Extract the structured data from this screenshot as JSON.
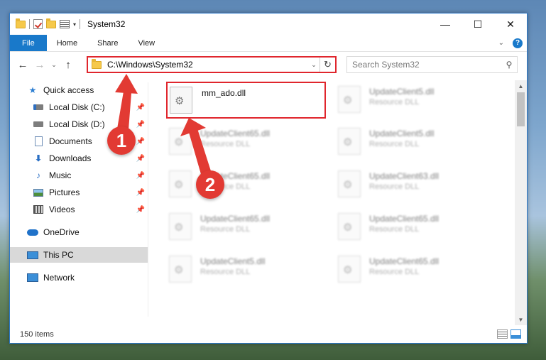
{
  "window": {
    "title": "System32",
    "controls": {
      "minimize": "—",
      "maximize": "☐",
      "close": "✕"
    }
  },
  "ribbon": {
    "tabs": [
      "File",
      "Home",
      "Share",
      "View"
    ],
    "expand_glyph": "⌄",
    "help_glyph": "?"
  },
  "address": {
    "path": "C:\\Windows\\System32",
    "search_placeholder": "Search System32",
    "nav_glyphs": {
      "back": "←",
      "forward": "→",
      "recent": "⌄",
      "up": "↑",
      "dropdown": "⌄",
      "refresh": "↻",
      "search": "⚲"
    }
  },
  "sidebar": {
    "items": [
      {
        "label": "Quick access",
        "icon": "star-icon",
        "pinned": false
      },
      {
        "label": "Local Disk (C:)",
        "icon": "drive-icon",
        "pinned": true
      },
      {
        "label": "Local Disk (D:)",
        "icon": "drive-icon",
        "pinned": true
      },
      {
        "label": "Documents",
        "icon": "document-icon",
        "pinned": true
      },
      {
        "label": "Downloads",
        "icon": "download-icon",
        "pinned": true
      },
      {
        "label": "Music",
        "icon": "music-icon",
        "pinned": true
      },
      {
        "label": "Pictures",
        "icon": "pictures-icon",
        "pinned": true
      },
      {
        "label": "Videos",
        "icon": "videos-icon",
        "pinned": true
      },
      {
        "label": "OneDrive",
        "icon": "cloud-icon",
        "pinned": false
      },
      {
        "label": "This PC",
        "icon": "computer-icon",
        "pinned": false,
        "selected": true
      },
      {
        "label": "Network",
        "icon": "network-icon",
        "pinned": false
      }
    ],
    "pin_glyph": "📌"
  },
  "files": [
    {
      "name": "mm_ado.dll",
      "type": "",
      "highlighted": true
    },
    {
      "name": "UpdateClient5.dll",
      "type": "Resource DLL"
    },
    {
      "name": "UpdateClient65.dll",
      "type": "Resource DLL"
    },
    {
      "name": "UpdateClient5.dll",
      "type": "Resource DLL"
    },
    {
      "name": "UpdateClient65.dll",
      "type": "Resource DLL"
    },
    {
      "name": "UpdateClient63.dll",
      "type": "Resource DLL"
    },
    {
      "name": "UpdateClient65.dll",
      "type": "Resource DLL"
    },
    {
      "name": "UpdateClient65.dll",
      "type": "Resource DLL"
    },
    {
      "name": "UpdateClient5.dll",
      "type": "Resource DLL"
    },
    {
      "name": "UpdateClient65.dll",
      "type": "Resource DLL"
    }
  ],
  "status": {
    "item_count": "150 items"
  },
  "annotations": {
    "step1": "1",
    "step2": "2",
    "color": "#e23a33"
  },
  "colors": {
    "accent": "#1979ca",
    "highlight_border": "#e0262d"
  }
}
